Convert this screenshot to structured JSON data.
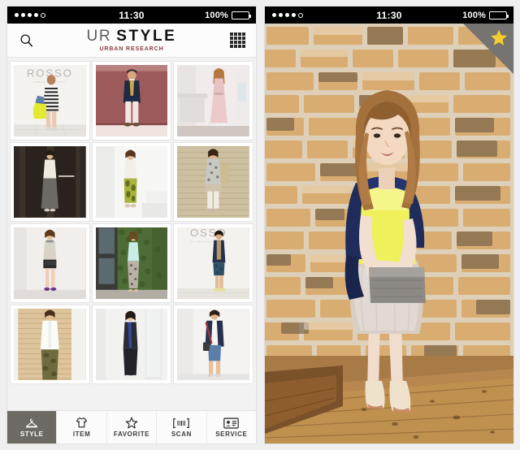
{
  "app": {
    "name": "UR STYLE",
    "brand_primary": "UR",
    "brand_secondary": "STYLE",
    "brand_subtitle": "URBAN RESEARCH",
    "brand_subtitle_color": "#8c3b44"
  },
  "status_bar": {
    "signal_dots_filled": 4,
    "signal_dots_empty": 1,
    "time": "11:30",
    "battery_text": "100%",
    "battery_level": 100
  },
  "left_screen": {
    "nav": {
      "search_icon": "search-icon",
      "grid_icon": "grid-view-icon"
    },
    "grid": {
      "columns": 3,
      "items": [
        {
          "id": 1,
          "alt": "Woman in striped dress with yellow bag, ROSSO backdrop",
          "overlay_text": "ROSSO",
          "bg": "#f3f1ee"
        },
        {
          "id": 2,
          "alt": "Man in navy blazer and white pants, red wall",
          "overlay_text": "",
          "bg": "#9d5a5a"
        },
        {
          "id": 3,
          "alt": "Woman in pink maxi dress in white interior",
          "overlay_text": "",
          "bg": "#f0e8e6"
        },
        {
          "id": 4,
          "alt": "Woman in white blouse and grey long skirt, dark doorway",
          "overlay_text": "",
          "bg": "#2b241f"
        },
        {
          "id": 5,
          "alt": "Woman in sheer top and green print trousers, white stairs",
          "overlay_text": "",
          "bg": "#f4f4f2"
        },
        {
          "id": 6,
          "alt": "Woman in printed tunic with straw tote, tile wall",
          "overlay_text": "",
          "bg": "#cfc3a4"
        },
        {
          "id": 7,
          "alt": "Woman in grey blouse and shorts with clutch",
          "overlay_text": "",
          "bg": "#efeceb"
        },
        {
          "id": 8,
          "alt": "Woman in mint top and patterned trousers, ivy wall",
          "overlay_text": "",
          "bg": "#4d6b38"
        },
        {
          "id": 9,
          "alt": "Man in navy jacket and printed shorts, ROSSO backdrop",
          "overlay_text": "OSSO",
          "bg": "#f2f0ed"
        },
        {
          "id": 10,
          "alt": "Man in white shirt and camo trousers, bamboo wall",
          "overlay_text": "",
          "bg": "#d9c5a4"
        },
        {
          "id": 11,
          "alt": "Woman in navy and black zip jacket, white interior",
          "overlay_text": "",
          "bg": "#f1f1f0"
        },
        {
          "id": 12,
          "alt": "Man in navy cardigan and denim shorts with red strap bag",
          "overlay_text": "",
          "bg": "#f3f2f1"
        }
      ]
    },
    "tabs": [
      {
        "key": "style",
        "label": "STYLE",
        "icon": "hanger-icon",
        "active": true
      },
      {
        "key": "item",
        "label": "ITEM",
        "icon": "tshirt-icon",
        "active": false
      },
      {
        "key": "favorite",
        "label": "FAVORITE",
        "icon": "star-icon",
        "active": false
      },
      {
        "key": "scan",
        "label": "SCAN",
        "icon": "barcode-icon",
        "active": false
      },
      {
        "key": "service",
        "label": "SERVICE",
        "icon": "id-card-icon",
        "active": false
      }
    ],
    "tab_active_bg": "#6c6a63"
  },
  "right_screen": {
    "photo": {
      "alt": "Woman smiling against brick wall wearing yellow top, grey tulle skirt, navy knit over shoulders, holding grey clutch, standing on wooden floor",
      "background": "exposed brick wall",
      "floor": "wooden plank floor"
    },
    "favorite_ribbon": {
      "icon": "star-icon",
      "star_color": "#f2cf2f",
      "ribbon_color": "#767470",
      "active": true
    }
  }
}
